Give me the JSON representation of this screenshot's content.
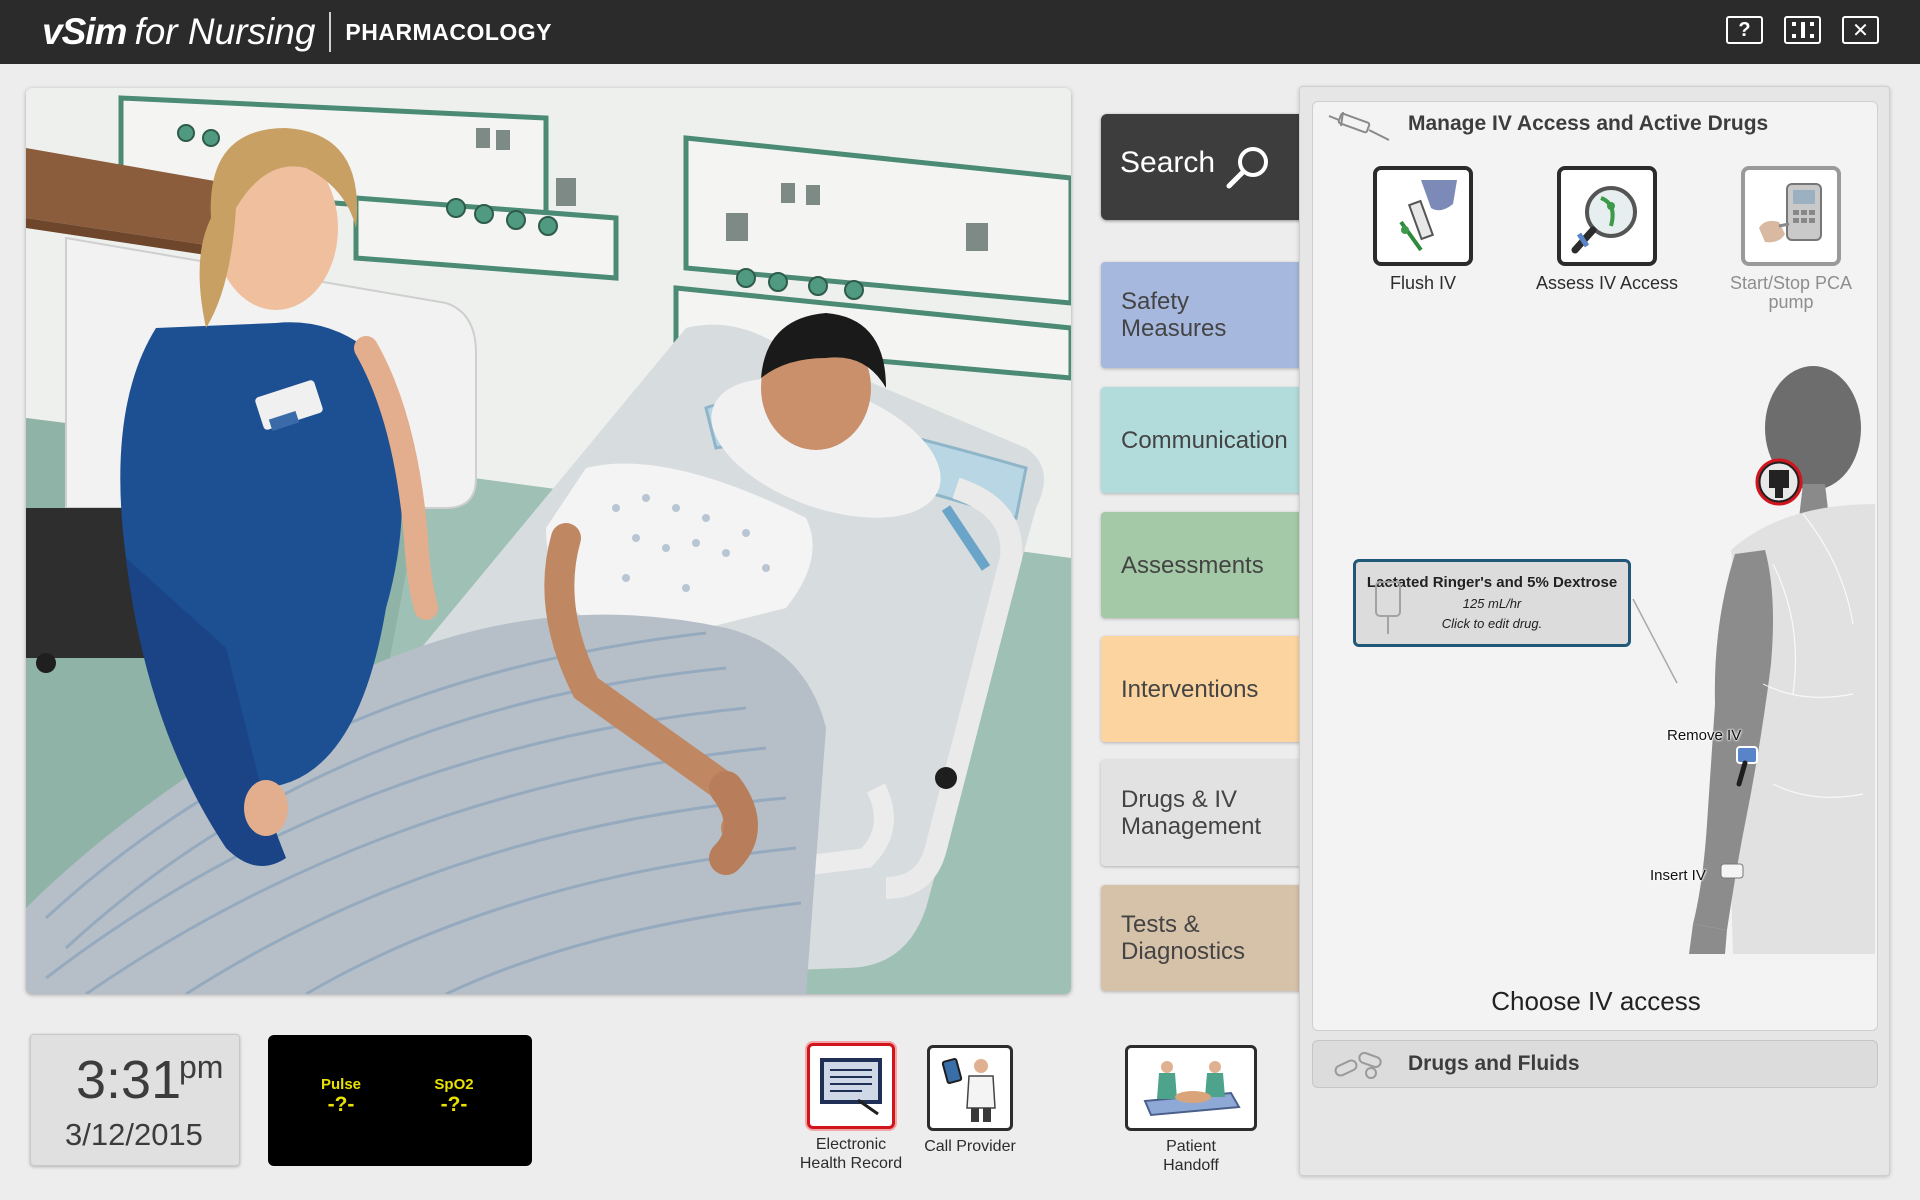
{
  "app": {
    "brand_vsim": "vSim",
    "brand_for": "for Nursing",
    "subtitle": "PHARMACOLOGY",
    "buttons": [
      {
        "name": "help-button",
        "glyph": "?"
      },
      {
        "name": "fullscreen-button",
        "glyph": "fullscreen-icon"
      },
      {
        "name": "close-button",
        "glyph": "✕"
      }
    ]
  },
  "clock": {
    "time": "3:31",
    "ampm": "pm",
    "date": "3/12/2015"
  },
  "vitals": [
    {
      "label": "Pulse",
      "value": "-?-"
    },
    {
      "label": "SpO2",
      "value": "-?-"
    }
  ],
  "toolbar": {
    "ehr_label": "Electronic\nHealth Record",
    "call_label": "Call Provider",
    "handoff_label": "Patient\nHandoff"
  },
  "menu": {
    "search_label": "Search",
    "categories": [
      {
        "label": "Safety Measures",
        "color": "#a6b8de"
      },
      {
        "label": "Communication",
        "color": "#b2dcdb"
      },
      {
        "label": "Assessments",
        "color": "#a4c9a7"
      },
      {
        "label": "Interventions",
        "color": "#fcd49f"
      },
      {
        "label": "Drugs & IV\nManagement",
        "color": "#e2e2e2"
      },
      {
        "label": "Tests &\nDiagnostics",
        "color": "#d6c1a9"
      }
    ]
  },
  "panel": {
    "title": "Manage IV Access and Active Drugs",
    "actions": [
      {
        "label": "Flush IV",
        "enabled": true
      },
      {
        "label": "Assess IV Access",
        "enabled": true
      },
      {
        "label": "Start/Stop PCA pump",
        "enabled": false
      }
    ],
    "drug": {
      "name": "Lactated Ringer's and 5% Dextrose",
      "rate": "125 mL/hr",
      "hint": "Click to edit drug."
    },
    "remove_iv_label": "Remove IV",
    "insert_iv_label": "Insert IV",
    "choose_text": "Choose IV access",
    "drugs_fluids_label": "Drugs and Fluids"
  }
}
